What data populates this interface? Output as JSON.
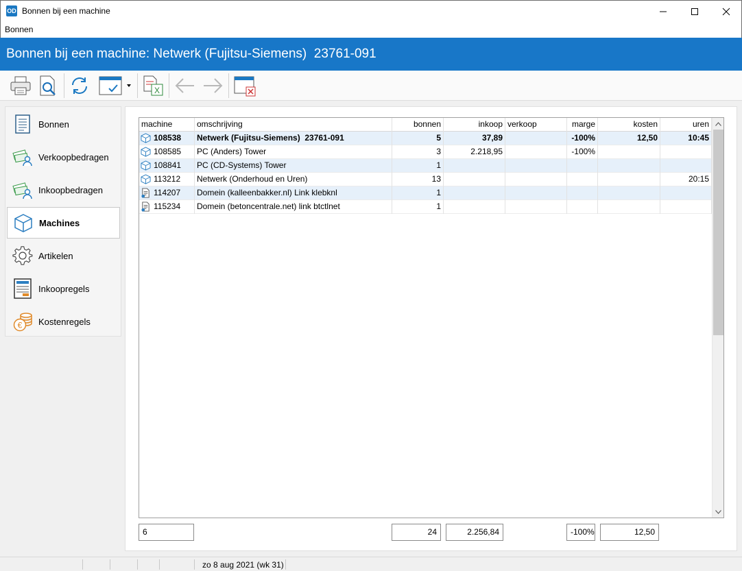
{
  "window": {
    "logo": "OD",
    "title": "Bonnen bij een machine"
  },
  "menu": {
    "items": [
      "Bonnen"
    ]
  },
  "header": {
    "title": "Bonnen bij een machine: Netwerk (Fujitsu-Siemens)  23761-091"
  },
  "toolbar": {
    "icons": [
      "print-icon",
      "print-preview-icon",
      "refresh-icon",
      "select-columns-icon",
      "export-excel-icon",
      "back-arrow-icon",
      "forward-arrow-icon",
      "close-window-icon"
    ]
  },
  "sidebar": {
    "items": [
      {
        "label": "Bonnen",
        "icon": "document-icon"
      },
      {
        "label": "Verkoopbedragen",
        "icon": "money-person-icon"
      },
      {
        "label": "Inkoopbedragen",
        "icon": "money-person-icon"
      },
      {
        "label": "Machines",
        "icon": "cube-icon",
        "active": true
      },
      {
        "label": "Artikelen",
        "icon": "gear-icon"
      },
      {
        "label": "Inkoopregels",
        "icon": "form-icon"
      },
      {
        "label": "Kostenregels",
        "icon": "coins-icon"
      }
    ]
  },
  "grid": {
    "columns": {
      "machine": "machine",
      "omschrijving": "omschrijving",
      "bonnen": "bonnen",
      "inkoop": "inkoop",
      "verkoop": "verkoop",
      "marge": "marge",
      "kosten": "kosten",
      "uren": "uren"
    },
    "rows": [
      {
        "icon": "cube-icon",
        "machine": "108538",
        "omschrijving": "Netwerk (Fujitsu-Siemens)  23761-091",
        "bonnen": "5",
        "inkoop": "37,89",
        "verkoop": "",
        "marge": "-100%",
        "kosten": "12,50",
        "uren": "10:45"
      },
      {
        "icon": "cube-icon",
        "machine": "108585",
        "omschrijving": "PC (Anders) Tower",
        "bonnen": "3",
        "inkoop": "2.218,95",
        "verkoop": "",
        "marge": "-100%",
        "kosten": "",
        "uren": ""
      },
      {
        "icon": "cube-icon",
        "machine": "108841",
        "omschrijving": "PC (CD-Systems) Tower",
        "bonnen": "1",
        "inkoop": "",
        "verkoop": "",
        "marge": "",
        "kosten": "",
        "uren": ""
      },
      {
        "icon": "cube-icon",
        "machine": "113212",
        "omschrijving": "Netwerk (Onderhoud en Uren)",
        "bonnen": "13",
        "inkoop": "",
        "verkoop": "",
        "marge": "",
        "kosten": "",
        "uren": "20:15"
      },
      {
        "icon": "domain-doc-icon",
        "machine": "114207",
        "omschrijving": "Domein (kalleenbakker.nl) Link klebknl",
        "bonnen": "1",
        "inkoop": "",
        "verkoop": "",
        "marge": "",
        "kosten": "",
        "uren": ""
      },
      {
        "icon": "domain-doc-icon",
        "machine": "115234",
        "omschrijving": "Domein (betoncentrale.net) link btctlnet",
        "bonnen": "1",
        "inkoop": "",
        "verkoop": "",
        "marge": "",
        "kosten": "",
        "uren": ""
      }
    ]
  },
  "totals": {
    "count": "6",
    "bonnen": "24",
    "inkoop": "2.256,84",
    "marge": "-100%",
    "kosten": "12,50"
  },
  "status": {
    "date": "zo 8 aug 2021 (wk 31)"
  },
  "colors": {
    "header": "#1877c8",
    "selected_row": "#e6f0fa",
    "icon_blue": "#2d7fc1",
    "icon_green": "#3a9a4a",
    "icon_orange": "#e08a2a"
  }
}
